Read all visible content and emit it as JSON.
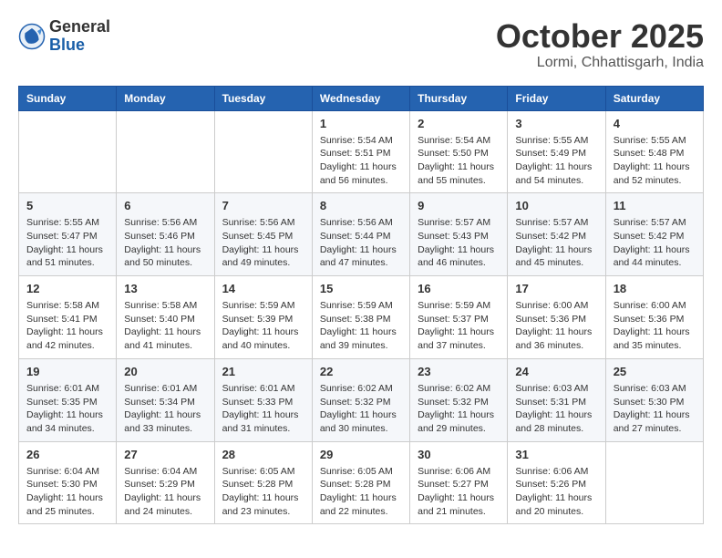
{
  "header": {
    "logo_general": "General",
    "logo_blue": "Blue",
    "month_title": "October 2025",
    "location": "Lormi, Chhattisgarh, India"
  },
  "weekdays": [
    "Sunday",
    "Monday",
    "Tuesday",
    "Wednesday",
    "Thursday",
    "Friday",
    "Saturday"
  ],
  "weeks": [
    [
      {
        "day": "",
        "info": ""
      },
      {
        "day": "",
        "info": ""
      },
      {
        "day": "",
        "info": ""
      },
      {
        "day": "1",
        "info": "Sunrise: 5:54 AM\nSunset: 5:51 PM\nDaylight: 11 hours\nand 56 minutes."
      },
      {
        "day": "2",
        "info": "Sunrise: 5:54 AM\nSunset: 5:50 PM\nDaylight: 11 hours\nand 55 minutes."
      },
      {
        "day": "3",
        "info": "Sunrise: 5:55 AM\nSunset: 5:49 PM\nDaylight: 11 hours\nand 54 minutes."
      },
      {
        "day": "4",
        "info": "Sunrise: 5:55 AM\nSunset: 5:48 PM\nDaylight: 11 hours\nand 52 minutes."
      }
    ],
    [
      {
        "day": "5",
        "info": "Sunrise: 5:55 AM\nSunset: 5:47 PM\nDaylight: 11 hours\nand 51 minutes."
      },
      {
        "day": "6",
        "info": "Sunrise: 5:56 AM\nSunset: 5:46 PM\nDaylight: 11 hours\nand 50 minutes."
      },
      {
        "day": "7",
        "info": "Sunrise: 5:56 AM\nSunset: 5:45 PM\nDaylight: 11 hours\nand 49 minutes."
      },
      {
        "day": "8",
        "info": "Sunrise: 5:56 AM\nSunset: 5:44 PM\nDaylight: 11 hours\nand 47 minutes."
      },
      {
        "day": "9",
        "info": "Sunrise: 5:57 AM\nSunset: 5:43 PM\nDaylight: 11 hours\nand 46 minutes."
      },
      {
        "day": "10",
        "info": "Sunrise: 5:57 AM\nSunset: 5:42 PM\nDaylight: 11 hours\nand 45 minutes."
      },
      {
        "day": "11",
        "info": "Sunrise: 5:57 AM\nSunset: 5:42 PM\nDaylight: 11 hours\nand 44 minutes."
      }
    ],
    [
      {
        "day": "12",
        "info": "Sunrise: 5:58 AM\nSunset: 5:41 PM\nDaylight: 11 hours\nand 42 minutes."
      },
      {
        "day": "13",
        "info": "Sunrise: 5:58 AM\nSunset: 5:40 PM\nDaylight: 11 hours\nand 41 minutes."
      },
      {
        "day": "14",
        "info": "Sunrise: 5:59 AM\nSunset: 5:39 PM\nDaylight: 11 hours\nand 40 minutes."
      },
      {
        "day": "15",
        "info": "Sunrise: 5:59 AM\nSunset: 5:38 PM\nDaylight: 11 hours\nand 39 minutes."
      },
      {
        "day": "16",
        "info": "Sunrise: 5:59 AM\nSunset: 5:37 PM\nDaylight: 11 hours\nand 37 minutes."
      },
      {
        "day": "17",
        "info": "Sunrise: 6:00 AM\nSunset: 5:36 PM\nDaylight: 11 hours\nand 36 minutes."
      },
      {
        "day": "18",
        "info": "Sunrise: 6:00 AM\nSunset: 5:36 PM\nDaylight: 11 hours\nand 35 minutes."
      }
    ],
    [
      {
        "day": "19",
        "info": "Sunrise: 6:01 AM\nSunset: 5:35 PM\nDaylight: 11 hours\nand 34 minutes."
      },
      {
        "day": "20",
        "info": "Sunrise: 6:01 AM\nSunset: 5:34 PM\nDaylight: 11 hours\nand 33 minutes."
      },
      {
        "day": "21",
        "info": "Sunrise: 6:01 AM\nSunset: 5:33 PM\nDaylight: 11 hours\nand 31 minutes."
      },
      {
        "day": "22",
        "info": "Sunrise: 6:02 AM\nSunset: 5:32 PM\nDaylight: 11 hours\nand 30 minutes."
      },
      {
        "day": "23",
        "info": "Sunrise: 6:02 AM\nSunset: 5:32 PM\nDaylight: 11 hours\nand 29 minutes."
      },
      {
        "day": "24",
        "info": "Sunrise: 6:03 AM\nSunset: 5:31 PM\nDaylight: 11 hours\nand 28 minutes."
      },
      {
        "day": "25",
        "info": "Sunrise: 6:03 AM\nSunset: 5:30 PM\nDaylight: 11 hours\nand 27 minutes."
      }
    ],
    [
      {
        "day": "26",
        "info": "Sunrise: 6:04 AM\nSunset: 5:30 PM\nDaylight: 11 hours\nand 25 minutes."
      },
      {
        "day": "27",
        "info": "Sunrise: 6:04 AM\nSunset: 5:29 PM\nDaylight: 11 hours\nand 24 minutes."
      },
      {
        "day": "28",
        "info": "Sunrise: 6:05 AM\nSunset: 5:28 PM\nDaylight: 11 hours\nand 23 minutes."
      },
      {
        "day": "29",
        "info": "Sunrise: 6:05 AM\nSunset: 5:28 PM\nDaylight: 11 hours\nand 22 minutes."
      },
      {
        "day": "30",
        "info": "Sunrise: 6:06 AM\nSunset: 5:27 PM\nDaylight: 11 hours\nand 21 minutes."
      },
      {
        "day": "31",
        "info": "Sunrise: 6:06 AM\nSunset: 5:26 PM\nDaylight: 11 hours\nand 20 minutes."
      },
      {
        "day": "",
        "info": ""
      }
    ]
  ]
}
